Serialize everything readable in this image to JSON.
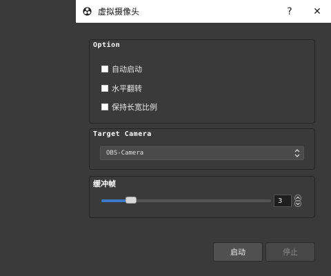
{
  "window": {
    "title": "虚拟摄像头",
    "help_label": "?",
    "close_label": "✕"
  },
  "option_group": {
    "title": "Option",
    "items": [
      {
        "label": "自动启动",
        "checked": false
      },
      {
        "label": "水平翻转",
        "checked": false
      },
      {
        "label": "保持长宽比例",
        "checked": false
      }
    ]
  },
  "camera_group": {
    "title": "Target Camera",
    "selected": "OBS-Camera"
  },
  "buffer_group": {
    "title": "缓冲帧",
    "value": "3",
    "slider_fraction": 0.15
  },
  "buttons": {
    "start_label": "启动",
    "stop_label": "停止"
  },
  "colors": {
    "accent": "#3a7ac9",
    "background": "#3a3a3a"
  }
}
